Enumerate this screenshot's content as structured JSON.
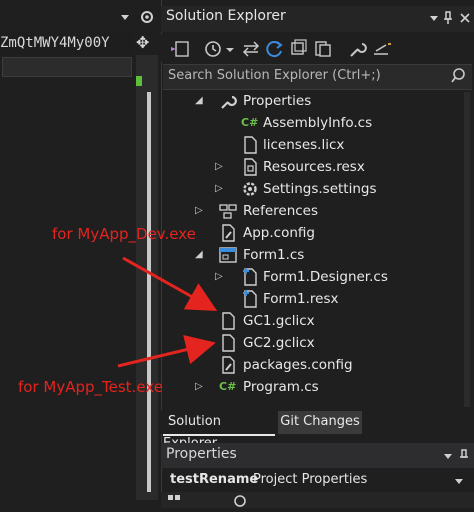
{
  "left": {
    "code_text": "ZmQtMWY4My00Y",
    "move_glyph": "✥"
  },
  "solution_explorer": {
    "title": "Solution Explorer",
    "search_placeholder": "Search Solution Explorer (Ctrl+;)",
    "tree": [
      {
        "label": "Properties",
        "icon": "wrench-icon"
      },
      {
        "label": "AssemblyInfo.cs",
        "icon": "csharp-icon"
      },
      {
        "label": "licenses.licx",
        "icon": "file-icon"
      },
      {
        "label": "Resources.resx",
        "icon": "resx-icon"
      },
      {
        "label": "Settings.settings",
        "icon": "settings-icon"
      },
      {
        "label": "References",
        "icon": "references-icon"
      },
      {
        "label": "App.config",
        "icon": "config-icon"
      },
      {
        "label": "Form1.cs",
        "icon": "form-icon"
      },
      {
        "label": "Form1.Designer.cs",
        "icon": "csharp-designer-icon"
      },
      {
        "label": "Form1.resx",
        "icon": "resx-icon"
      },
      {
        "label": "GC1.gclicx",
        "icon": "file-icon"
      },
      {
        "label": "GC2.gclicx",
        "icon": "file-icon"
      },
      {
        "label": "packages.config",
        "icon": "config-icon"
      },
      {
        "label": "Program.cs",
        "icon": "csharp-icon"
      }
    ],
    "csharp_glyph": "C#",
    "tabs": {
      "active": "Solution Explorer",
      "inactive": "Git Changes"
    }
  },
  "properties": {
    "title": "Properties",
    "object_name": "testRename",
    "object_type": "Project Properties"
  },
  "annotations": {
    "dev": "for MyApp_Dev.exe",
    "test": "for MyApp_Test.exe"
  },
  "colors": {
    "annotation": "#e3241f",
    "accent_blue": "#3c8cdc",
    "csharp_green": "#6cbf4a"
  }
}
